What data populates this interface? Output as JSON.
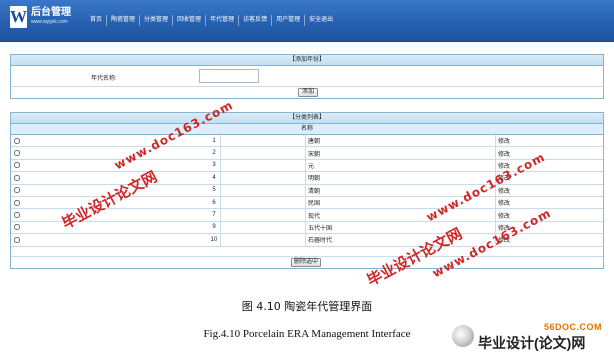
{
  "logo": {
    "mark": "W",
    "title": "后台管理",
    "subtitle": "www.wygsk.com"
  },
  "nav": [
    "首页",
    "陶瓷管理",
    "分类管理",
    "回收管理",
    "年代管理",
    "访客反馈",
    "用户管理",
    "安全退出"
  ],
  "add_panel": {
    "title": "【添加年份】",
    "label": "年代名称:",
    "input_value": "",
    "button": "添加"
  },
  "list_panel": {
    "title": "【分类列表】",
    "column_header": "名称",
    "rows": [
      {
        "id": "1",
        "name": "唐朝",
        "action": "修改"
      },
      {
        "id": "2",
        "name": "宋朝",
        "action": "修改"
      },
      {
        "id": "3",
        "name": "元",
        "action": "修改"
      },
      {
        "id": "4",
        "name": "明朝",
        "action": "修改"
      },
      {
        "id": "5",
        "name": "清朝",
        "action": "修改"
      },
      {
        "id": "6",
        "name": "民国",
        "action": "修改"
      },
      {
        "id": "7",
        "name": "现代",
        "action": "修改"
      },
      {
        "id": "9",
        "name": "五代十国",
        "action": "修改"
      },
      {
        "id": "10",
        "name": "石器时代",
        "action": "修改"
      }
    ],
    "delete_button": "删除选中"
  },
  "caption_cn": "图 4.10 陶瓷年代管理界面",
  "caption_en": "Fig.4.10 Porcelain ERA Management Interface",
  "watermarks": {
    "url": "www.doc163.com",
    "text": "毕业设计论文网"
  },
  "site_badge": {
    "top": "56DOC.COM",
    "text": "毕业设计(论文)网"
  },
  "colors": {
    "header": "#2660b0",
    "panel_border": "#8ab3cf",
    "watermark": "#cc1111"
  }
}
